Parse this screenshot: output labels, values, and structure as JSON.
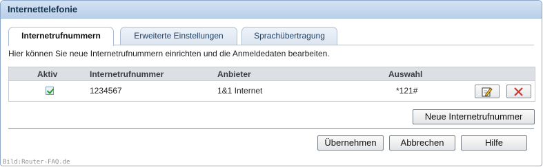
{
  "window": {
    "title": "Internettelefonie"
  },
  "tabs": [
    {
      "label": "Internetrufnummern",
      "active": true
    },
    {
      "label": "Erweiterte Einstellungen",
      "active": false
    },
    {
      "label": "Sprachübertragung",
      "active": false
    }
  ],
  "intro_text": "Hier können Sie neue Internetrufnummern einrichten und die Anmeldedaten bearbeiten.",
  "table": {
    "columns": [
      "Aktiv",
      "Internetrufnummer",
      "Anbieter",
      "Auswahl"
    ],
    "rows": [
      {
        "aktiv": true,
        "nummer": "1234567",
        "anbieter": "1&1 Internet",
        "auswahl": "*121#",
        "edit_icon": "edit-icon",
        "delete_icon": "delete-x-icon"
      }
    ]
  },
  "buttons": {
    "new_number": "Neue Internetrufnummer",
    "apply": "Übernehmen",
    "cancel": "Abbrechen",
    "help": "Hilfe"
  },
  "watermark": "Bild:Router-FAQ.de",
  "colors": {
    "header_bg": "#c6d8ee",
    "delete_red": "#d0342c",
    "check_green": "#21a121"
  }
}
